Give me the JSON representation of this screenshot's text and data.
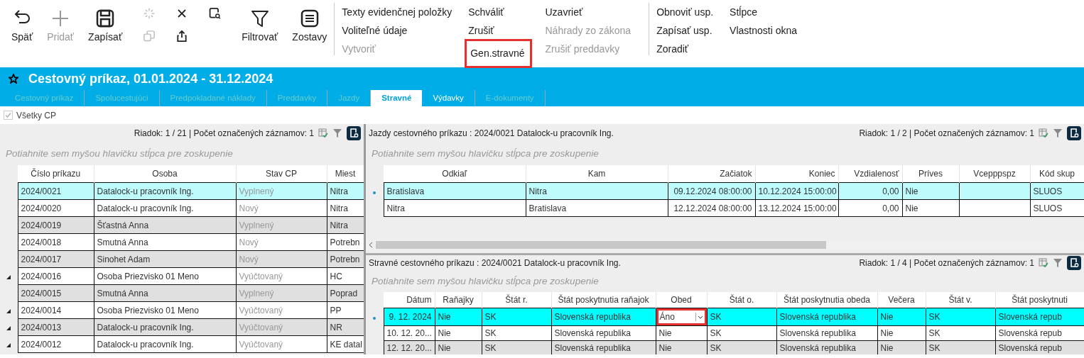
{
  "toolbar": {
    "tools": [
      {
        "kind": "large",
        "label": "Späť",
        "disabled": false
      },
      {
        "kind": "large",
        "label": "Pridať",
        "disabled": true
      },
      {
        "kind": "large",
        "label": "Zapísať",
        "disabled": false
      },
      {
        "kind": "small",
        "disabled": true
      },
      {
        "kind": "small",
        "disabled": true
      },
      {
        "kind": "small",
        "disabled": false
      },
      {
        "kind": "small",
        "disabled": false
      },
      {
        "kind": "small",
        "disabled": false
      },
      {
        "kind": "large",
        "label": "Filtrovať",
        "disabled": false
      },
      {
        "kind": "large",
        "label": "Zostavy",
        "disabled": false
      }
    ],
    "menu_groups": [
      {
        "columns": [
          {
            "items": [
              {
                "label": "Texty evidenčnej položky",
                "disabled": false,
                "highlighted": false
              },
              {
                "label": "Voliteľné údaje",
                "disabled": false,
                "highlighted": false
              },
              {
                "label": "Vytvoriť",
                "disabled": true,
                "highlighted": false
              }
            ]
          },
          {
            "items": [
              {
                "label": "Schváliť",
                "disabled": false,
                "highlighted": false
              },
              {
                "label": "Zrušiť",
                "disabled": false,
                "highlighted": false
              },
              {
                "label": "Gen.stravné",
                "disabled": false,
                "highlighted": true
              }
            ]
          },
          {
            "items": [
              {
                "label": "Uzavrieť",
                "disabled": false,
                "highlighted": false
              },
              {
                "label": "Náhrady zo zákona",
                "disabled": true,
                "highlighted": false
              },
              {
                "label": "Zrušiť preddavky",
                "disabled": true,
                "highlighted": false
              }
            ]
          }
        ]
      },
      {
        "columns": [
          {
            "items": [
              {
                "label": "Obnoviť usp.",
                "disabled": false,
                "highlighted": false
              },
              {
                "label": "Zapísať usp.",
                "disabled": false,
                "highlighted": false
              },
              {
                "label": "Zoradiť",
                "disabled": false,
                "highlighted": false
              }
            ]
          },
          {
            "items": [
              {
                "label": "Stĺpce",
                "disabled": false,
                "highlighted": false
              },
              {
                "label": "Vlastnosti okna",
                "disabled": false,
                "highlighted": false
              }
            ]
          }
        ]
      }
    ]
  },
  "document": {
    "title": "Cestovný príkaz, 01.01.2024 - 31.12.2024",
    "tabs": [
      {
        "label": "Cestovný príkaz",
        "selected": false,
        "disabled": true
      },
      {
        "label": "Spolucestujúci",
        "selected": false,
        "disabled": true
      },
      {
        "label": "Predpokladané náklady",
        "selected": false,
        "disabled": true
      },
      {
        "label": "Preddavky",
        "selected": false,
        "disabled": true
      },
      {
        "label": "Jazdy",
        "selected": false,
        "disabled": true
      },
      {
        "label": "Stravné",
        "selected": true,
        "disabled": false
      },
      {
        "label": "Výdavky",
        "selected": false,
        "disabled": false
      },
      {
        "label": "E-dokumenty",
        "selected": false,
        "disabled": true
      }
    ]
  },
  "filter_checkbox": {
    "label": "Všetky CP",
    "checked": true,
    "disabled": true
  },
  "panels": [
    {
      "status": "Riadok: 1 / 21 | Počet označených záznamov: 1",
      "group_hint": "Potiahnite sem myšou hlavičku stĺpca pre zoskupenie",
      "columns": [
        {
          "label": "Číslo príkazu",
          "kind": "text"
        },
        {
          "label": "Osoba",
          "kind": "text"
        },
        {
          "label": "Stav CP",
          "kind": "muted"
        },
        {
          "label": "Miest",
          "kind": "text"
        }
      ],
      "rows": [
        {
          "selected": true,
          "marked": false,
          "cells": [
            "2024/0021",
            "Datalock-u pracovník Ing.",
            "Vyplnený",
            "Nitra"
          ]
        },
        {
          "selected": false,
          "marked": false,
          "cells": [
            "2024/0020",
            "Datalock-u pracovník Ing.",
            "Nový",
            "Nitra"
          ]
        },
        {
          "selected": false,
          "marked": false,
          "cells": [
            "2024/0019",
            "Šťastná Anna",
            "Vyplnený",
            "Nitra"
          ]
        },
        {
          "selected": false,
          "marked": false,
          "cells": [
            "2024/0018",
            "Smutná Anna",
            "Nový",
            "Potrebn"
          ]
        },
        {
          "selected": false,
          "marked": false,
          "cells": [
            "2024/0017",
            "Sinohet Adam",
            "Nový",
            "Potrebn"
          ]
        },
        {
          "selected": false,
          "marked": true,
          "cells": [
            "2024/0016",
            "Osoba Priezvisko 01 Meno",
            "Vyúčtovaný",
            "HC"
          ]
        },
        {
          "selected": false,
          "marked": false,
          "cells": [
            "2024/0015",
            "Smutná Anna",
            "Vyplnený",
            "Poprad"
          ]
        },
        {
          "selected": false,
          "marked": true,
          "cells": [
            "2024/0014",
            "Osoba Priezvisko 01 Meno",
            "Vyúčtovaný",
            "PP"
          ]
        },
        {
          "selected": false,
          "marked": true,
          "cells": [
            "2024/0013",
            "Datalock-u pracovník Ing.",
            "Vyúčtovaný",
            "NR"
          ]
        },
        {
          "selected": false,
          "marked": true,
          "cells": [
            "2024/0012",
            "Datalock-u pracovník Ing.",
            "Vyúčtovaný",
            "KE datal"
          ]
        }
      ]
    },
    {
      "title": "Jazdy cestovného príkazu : 2024/0021 Datalock-u pracovník Ing.",
      "status": "Riadok: 1 / 2 | Počet označených záznamov: 1",
      "group_hint": "Potiahnite sem myšou hlavičku stĺpca pre zoskupenie",
      "columns": [
        {
          "label": "Odkiaľ",
          "kind": "text"
        },
        {
          "label": "Kam",
          "kind": "text"
        },
        {
          "label": "Začiatok",
          "kind": "number"
        },
        {
          "label": "Koniec",
          "kind": "number"
        },
        {
          "label": "Vzdialenosť",
          "kind": "number"
        },
        {
          "label": "Príves",
          "kind": "text"
        },
        {
          "label": "Vcepppspz",
          "kind": "text"
        },
        {
          "label": "Kód skup",
          "kind": "text"
        }
      ],
      "rows": [
        {
          "selected": true,
          "marked": false,
          "cells": [
            "Bratislava",
            "Nitra",
            "09.12.2024 08:00:00",
            "10.12.2024 15:00:00",
            "0,00",
            "Nie",
            "",
            "SLUOS"
          ]
        },
        {
          "selected": false,
          "marked": false,
          "cells": [
            "Nitra",
            "Bratislava",
            "12.12.2024 08:00:00",
            "13.12.2024 15:00:00",
            "0,00",
            "Nie",
            "",
            "SLUOS"
          ]
        }
      ]
    },
    {
      "title": "Stravné cestovného príkazu : 2024/0021 Datalock-u pracovník Ing.",
      "status": "Riadok: 1 / 4 | Počet označených záznamov: 1",
      "group_hint": "Potiahnite sem myšou hlavičku stĺpca pre zoskupenie",
      "columns": [
        {
          "label": "Dátum",
          "kind": "number"
        },
        {
          "label": "Raňajky",
          "kind": "text"
        },
        {
          "label": "Štát r.",
          "kind": "text"
        },
        {
          "label": "Štát poskytnutia raňajok",
          "kind": "text"
        },
        {
          "label": "Obed",
          "kind": "text"
        },
        {
          "label": "Štát o.",
          "kind": "text"
        },
        {
          "label": "Štát poskytnutia obeda",
          "kind": "text"
        },
        {
          "label": "Večera",
          "kind": "text"
        },
        {
          "label": "Štát v.",
          "kind": "text"
        },
        {
          "label": "Štát poskytnuti",
          "kind": "text"
        }
      ],
      "rows": [
        {
          "selected": true,
          "marked": false,
          "cells": [
            "9. 12. 2024",
            "Nie",
            "SK",
            "Slovenská republika",
            {
              "kind": "dropdown",
              "value": "Áno",
              "highlighted": true
            },
            "SK",
            "Slovenská republika",
            "Nie",
            "SK",
            "Slovenská repub"
          ]
        },
        {
          "selected": false,
          "marked": false,
          "cells": [
            "10. 12. 20...",
            "Nie",
            "SK",
            "Slovenská republika",
            "Nie",
            "SK",
            "Slovenská republika",
            "Nie",
            "SK",
            "Slovenská repub"
          ]
        },
        {
          "selected": false,
          "marked": false,
          "cells": [
            "12. 12. 20...",
            "Nie",
            "SK",
            "Slovenská republika",
            "Nie",
            "SK",
            "Slovenská republika",
            "Nie",
            "SK",
            "Slovenská repub"
          ]
        }
      ]
    }
  ]
}
